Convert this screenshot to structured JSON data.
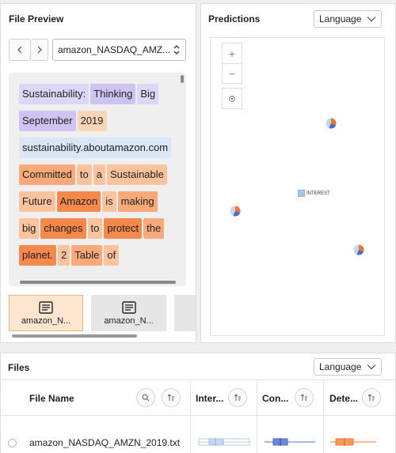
{
  "file_preview": {
    "title": "File Preview",
    "selected_file": "amazon_NASDAQ_AMZ...",
    "tokens": [
      {
        "text": "Sustainability:",
        "color": "#dcd6f7"
      },
      {
        "text": "Thinking",
        "color": "#cec4f2"
      },
      {
        "text": "Big",
        "color": "#dcd6f7"
      },
      {
        "text": "September",
        "color": "#cec4f2"
      },
      {
        "text": "2019",
        "color": "#fcd5b8"
      },
      {
        "text": "sustainability.aboutamazon.com",
        "color": "#d9e6f6"
      },
      {
        "text": "Committed",
        "color": "#f9a97a"
      },
      {
        "text": "to",
        "color": "#fbc39d"
      },
      {
        "text": "a",
        "color": "#fbc39d"
      },
      {
        "text": "Sustainable",
        "color": "#fbc39d"
      },
      {
        "text": "Future",
        "color": "#fbc39d"
      },
      {
        "text": "Amazon",
        "color": "#f4894b"
      },
      {
        "text": "is",
        "color": "#fbc39d"
      },
      {
        "text": "making",
        "color": "#f9a97a"
      },
      {
        "text": "big",
        "color": "#fbc39d"
      },
      {
        "text": "changes",
        "color": "#f4894b"
      },
      {
        "text": "to",
        "color": "#fbc39d"
      },
      {
        "text": "protect",
        "color": "#f4894b"
      },
      {
        "text": "the",
        "color": "#f9a97a"
      },
      {
        "text": "planet.",
        "color": "#f4894b"
      },
      {
        "text": "2",
        "color": "#fbc39d"
      },
      {
        "text": "Table",
        "color": "#f9a97a"
      },
      {
        "text": "of",
        "color": "#fbc39d"
      }
    ],
    "thumbnails": [
      {
        "label": "amazon_N...",
        "selected": true
      },
      {
        "label": "amazon_N...",
        "selected": false
      }
    ]
  },
  "predictions": {
    "title": "Predictions",
    "dropdown_value": "Language",
    "zoom_in": "+",
    "zoom_out": "−",
    "locate_icon": "locate-icon",
    "legend_label": "INTEREST",
    "pie_colors": [
      "#f0772f",
      "#4b6cc1",
      "#c5d6ee"
    ]
  },
  "files": {
    "title": "Files",
    "dropdown_value": "Language",
    "columns": [
      "File Name",
      "Inter...",
      "Con...",
      "Dete..."
    ],
    "rows": [
      {
        "file_name": "amazon_NASDAQ_AMZN_2019.txt"
      }
    ]
  },
  "colors": {
    "accent_orange": "#f0772f",
    "accent_blue": "#4b6cc1",
    "light_blue": "#a8c8e8"
  }
}
